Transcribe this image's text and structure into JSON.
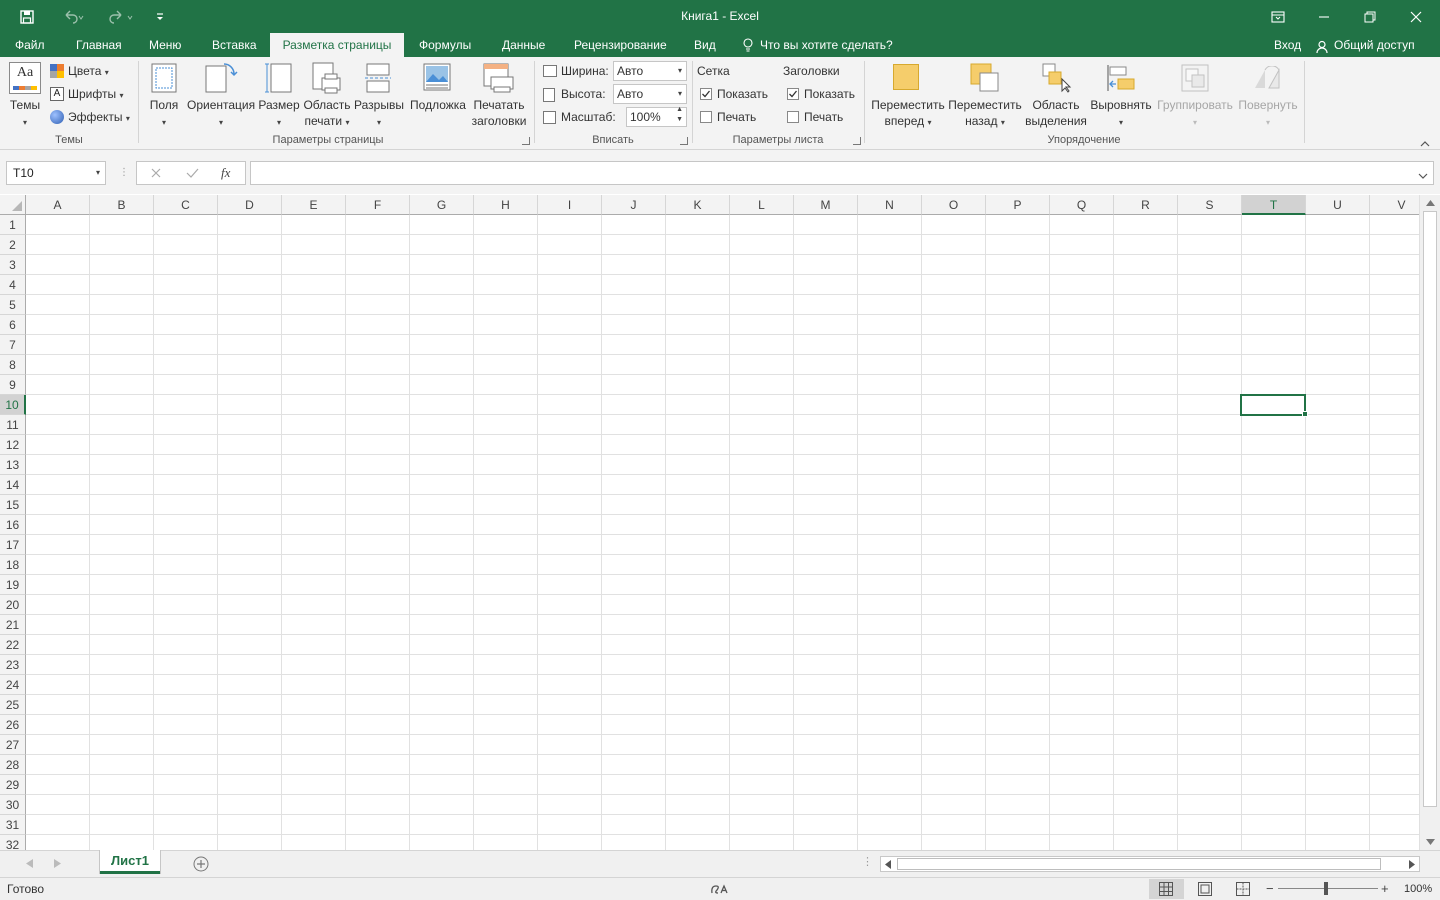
{
  "window": {
    "title": "Книга1 - Excel"
  },
  "tabs": [
    "Файл",
    "Главная",
    "Меню",
    "Вставка",
    "Разметка страницы",
    "Формулы",
    "Данные",
    "Рецензирование",
    "Вид"
  ],
  "tell_me": "Что вы хотите сделать?",
  "account": {
    "login": "Вход",
    "share": "Общий доступ"
  },
  "ribbon": {
    "themes": {
      "themes": "Темы",
      "colors": "Цвета",
      "fonts": "Шрифты",
      "effects": "Эффекты",
      "group": "Темы"
    },
    "page_setup": {
      "margins": "Поля",
      "orientation": "Ориентация",
      "size": "Размер",
      "print_area_1": "Область",
      "print_area_2": "печати",
      "breaks": "Разрывы",
      "background": "Подложка",
      "print_titles_1": "Печатать",
      "print_titles_2": "заголовки",
      "group": "Параметры страницы"
    },
    "scale_to_fit": {
      "width_label": "Ширина:",
      "width_value": "Авто",
      "height_label": "Высота:",
      "height_value": "Авто",
      "scale_label": "Масштаб:",
      "scale_value": "100%",
      "group": "Вписать"
    },
    "sheet_options": {
      "gridlines": "Сетка",
      "headings": "Заголовки",
      "view": "Показать",
      "print": "Печать",
      "group": "Параметры листа"
    },
    "arrange": {
      "bring_forward_1": "Переместить",
      "bring_forward_2": "вперед",
      "send_backward_1": "Переместить",
      "send_backward_2": "назад",
      "selection_pane_1": "Область",
      "selection_pane_2": "выделения",
      "align": "Выровнять",
      "group_btn": "Группировать",
      "rotate": "Повернуть",
      "group": "Упорядочение"
    }
  },
  "formula_bar": {
    "name_box": "T10",
    "fx": "fx"
  },
  "grid": {
    "columns": [
      "A",
      "B",
      "C",
      "D",
      "E",
      "F",
      "G",
      "H",
      "I",
      "J",
      "K",
      "L",
      "M",
      "N",
      "O",
      "P",
      "Q",
      "R",
      "S",
      "T",
      "U",
      "V"
    ],
    "rows": [
      "1",
      "2",
      "3",
      "4",
      "5",
      "6",
      "7",
      "8",
      "9",
      "10",
      "11",
      "12",
      "13",
      "14",
      "15",
      "16",
      "17",
      "18",
      "19",
      "20",
      "21",
      "22",
      "23",
      "24",
      "25",
      "26",
      "27",
      "28",
      "29",
      "30",
      "31",
      "32"
    ],
    "selected_column": "T",
    "selected_row": "10"
  },
  "sheets": {
    "active": "Лист1"
  },
  "status": {
    "ready": "Готово",
    "zoom": "100%"
  },
  "colors": {
    "accent": "#217346",
    "ribbon_bg": "#f3f3f3"
  }
}
